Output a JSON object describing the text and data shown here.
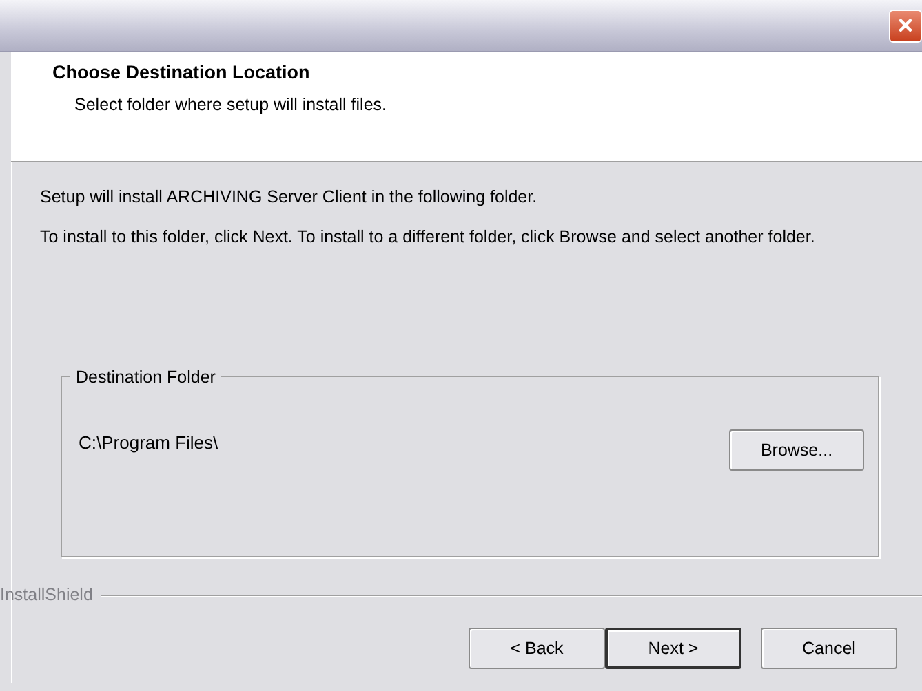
{
  "window": {
    "close": "×"
  },
  "header": {
    "title": "Choose Destination Location",
    "subtitle": "Select folder where setup will install files."
  },
  "body": {
    "paragraphs": [
      "Setup will install ARCHIVING Server Client in the following folder.",
      "To install to this folder, click Next. To install to a different folder, click Browse and select another folder."
    ]
  },
  "destination": {
    "legend": "Destination Folder",
    "path": "C:\\Program Files\\",
    "browse": "Browse..."
  },
  "brand": "InstallShield",
  "buttons": [
    {
      "label": "< Back",
      "default": false
    },
    {
      "label": "Next >",
      "default": true
    },
    {
      "label": "Cancel",
      "default": false
    }
  ]
}
